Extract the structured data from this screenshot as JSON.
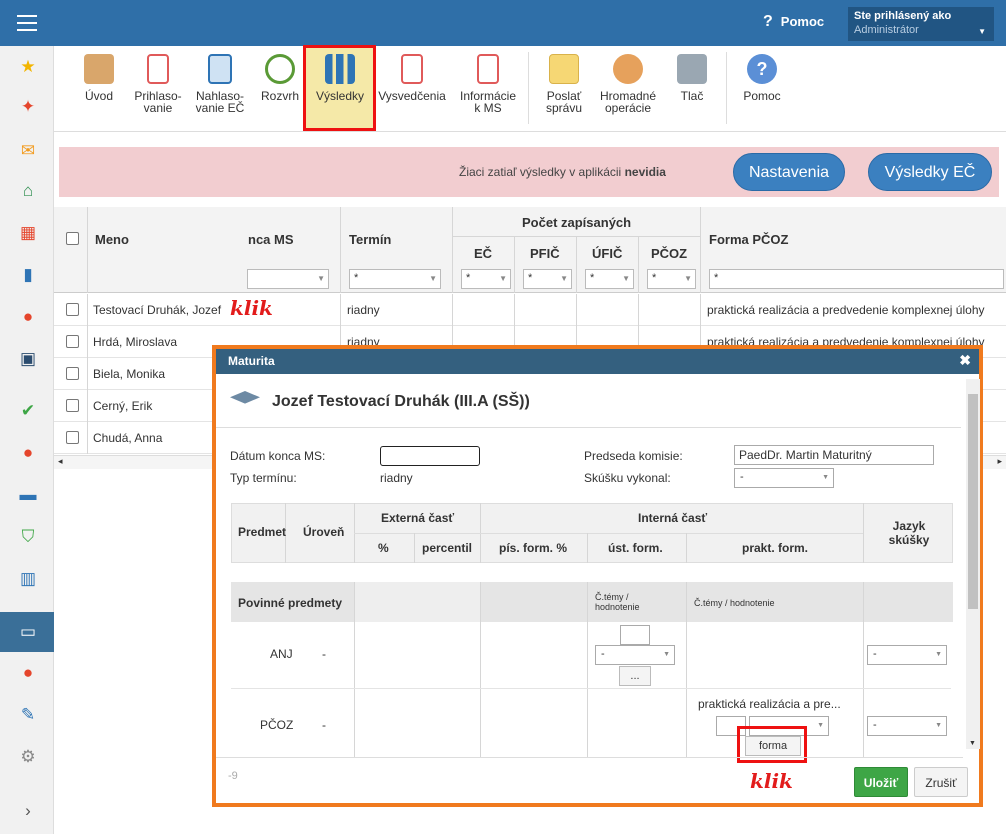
{
  "topbar": {
    "help_label": "Pomoc",
    "user_line1": "Ste prihlásený ako",
    "user_line2": "Administrátor"
  },
  "toolbar": {
    "items": [
      {
        "label": "Úvod",
        "icon": "students-icon"
      },
      {
        "label": "Prihlaso-\nvanie",
        "icon": "document-icon"
      },
      {
        "label": "Nahlaso-\nvanie EČ",
        "icon": "import-icon"
      },
      {
        "label": "Rozvrh",
        "icon": "clock-icon"
      },
      {
        "label": "Výsledky",
        "icon": "bar-chart-icon"
      },
      {
        "label": "Vysvedčenia",
        "icon": "certificate-icon"
      },
      {
        "label": "Informácie\nk MS",
        "icon": "info-document-icon"
      },
      {
        "label": "Poslať\nsprávu",
        "icon": "envelope-icon"
      },
      {
        "label": "Hromadné\noperácie",
        "icon": "group-icon"
      },
      {
        "label": "Tlač",
        "icon": "printer-icon"
      },
      {
        "label": "Pomoc",
        "icon": "help-icon"
      }
    ]
  },
  "alert": {
    "text_prefix": "Žiaci zatiaľ výsledky v aplikácii ",
    "text_bold": "nevidia",
    "btn1": "Nastavenia",
    "btn2": "Výsledky EČ"
  },
  "grid": {
    "headers": {
      "name": "Meno",
      "date": "nca MS",
      "term": "Termín",
      "count_group": "Počet zapísaných",
      "ec": "EČ",
      "pfic": "PFIČ",
      "ufic": "ÚFIČ",
      "pcoz": "PČOZ",
      "form": "Forma PČOZ"
    },
    "filter_star": "*",
    "rows": [
      {
        "name": "Testovací Druhák, Jozef",
        "term": "riadny",
        "form": "praktická realizácia a predvedenie komplexnej úlohy"
      },
      {
        "name": "Hrdá, Miroslava",
        "term": "riadny",
        "form": "praktická realizácia a predvedenie komplexnej úlohy"
      },
      {
        "name": "Biela, Monika",
        "term": "",
        "form": ""
      },
      {
        "name": "Cerný, Erik",
        "term": "",
        "form": ""
      },
      {
        "name": "Chudá, Anna",
        "term": "",
        "form": ""
      }
    ]
  },
  "annotation": "klik",
  "modal": {
    "header": "Maturita",
    "title": "Jozef Testovací Druhák (III.A (SŠ))",
    "date_label": "Dátum konca MS:",
    "term_label": "Typ termínu:",
    "term_value": "riadny",
    "chair_label": "Predseda komisie:",
    "chair_value": "PaedDr. Martin Maturitný",
    "exam_label": "Skúšku vykonal:",
    "exam_value": "-",
    "table": {
      "subject": "Predmet",
      "level": "Úroveň",
      "external": "Externá časť",
      "internal": "Interná časť",
      "lang": "Jazyk skúšky",
      "pct": "%",
      "percentil": "percentil",
      "written": "pís. form. %",
      "oral": "úst. form.",
      "practical": "prakt. form.",
      "section": "Povinné predmety",
      "sub_oral": "Č.témy / hodnotenie",
      "sub_prak": "Č.témy / hodnotenie",
      "rows": [
        {
          "subject": "ANJ",
          "level": "-",
          "oral_sel": "-",
          "btn": "...",
          "lang": "-"
        },
        {
          "subject": "PČOZ",
          "level": "-",
          "prak_text": "praktická realizácia a pre...",
          "btn": "forma",
          "lang": "-"
        }
      ]
    },
    "footer_hint": "-9",
    "save": "Uložiť",
    "cancel": "Zrušiť"
  }
}
